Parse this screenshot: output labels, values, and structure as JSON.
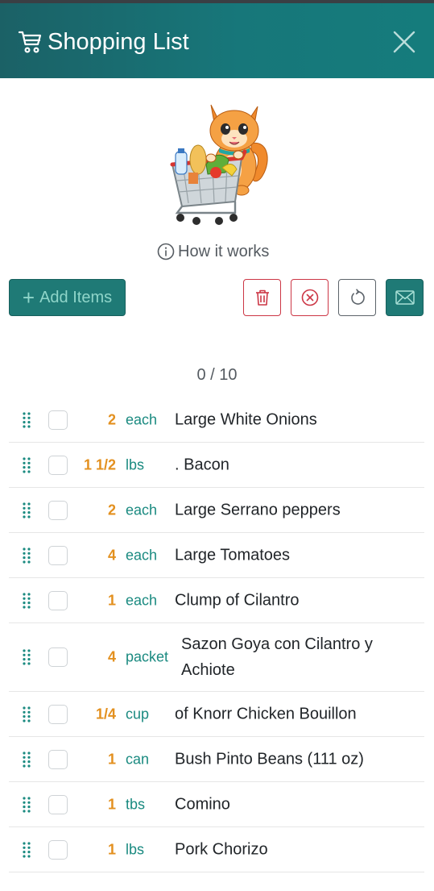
{
  "header": {
    "title": "Shopping List",
    "cart_icon": "cart-icon",
    "close_icon": "close-icon"
  },
  "mascot": {
    "alt": "cat-with-shopping-cart-image"
  },
  "how_it_works": {
    "label": "How it works",
    "icon": "info-icon"
  },
  "toolbar": {
    "add_label": "Add Items",
    "add_icon": "plus-icon",
    "trash_icon": "trash-icon",
    "clear_icon": "x-circle-icon",
    "reset_icon": "refresh-icon",
    "mail_icon": "envelope-icon"
  },
  "counter": "0 / 10",
  "items": [
    {
      "qty": "2",
      "unit": "each",
      "name": "Large White Onions"
    },
    {
      "qty": "1 1/2",
      "unit": "lbs",
      "name": ". Bacon"
    },
    {
      "qty": "2",
      "unit": "each",
      "name": "Large Serrano peppers"
    },
    {
      "qty": "4",
      "unit": "each",
      "name": "Large Tomatoes"
    },
    {
      "qty": "1",
      "unit": "each",
      "name": "Clump of Cilantro"
    },
    {
      "qty": "4",
      "unit": "packet",
      "name": "Sazon Goya con Cilantro y Achiote"
    },
    {
      "qty": "1/4",
      "unit": "cup",
      "name": "of Knorr Chicken Bouillon"
    },
    {
      "qty": "1",
      "unit": "can",
      "name": "Bush Pinto Beans (111 oz)"
    },
    {
      "qty": "1",
      "unit": "tbs",
      "name": "Comino"
    },
    {
      "qty": "1",
      "unit": "lbs",
      "name": "Pork Chorizo"
    }
  ],
  "colors": {
    "header": "#17777a",
    "accent": "#1f7a76",
    "qty": "#e3901f",
    "unit": "#1a8a80",
    "danger": "#cc3645"
  }
}
